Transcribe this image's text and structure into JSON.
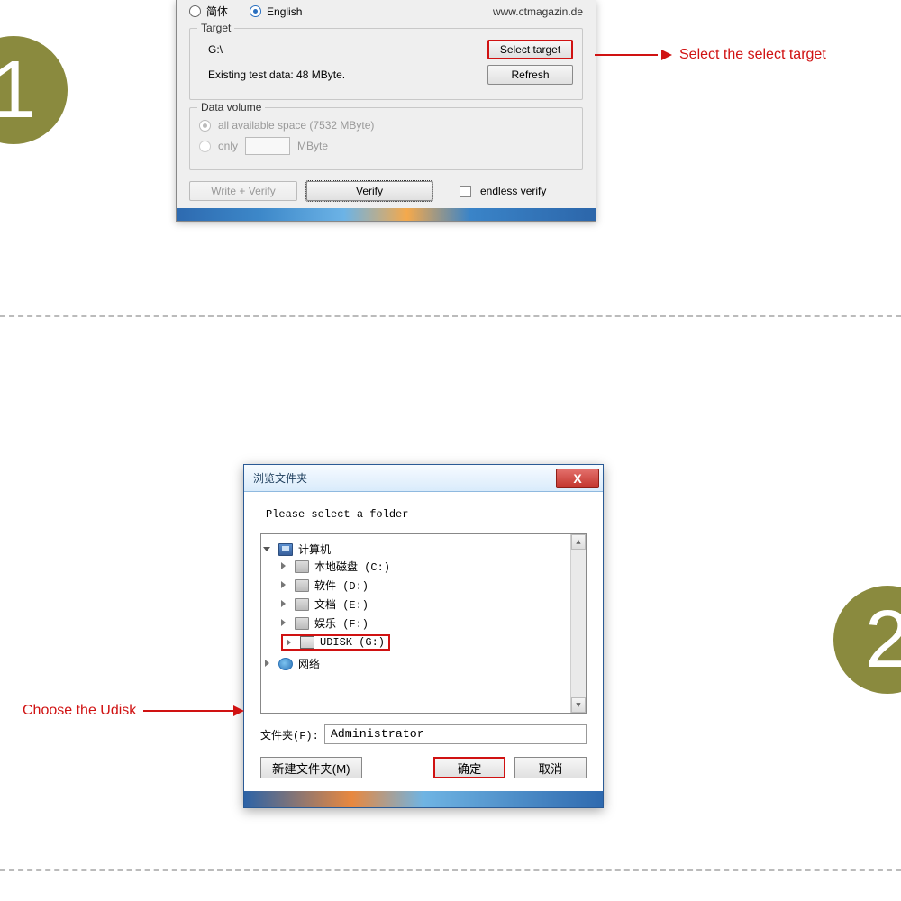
{
  "badges": {
    "one": "1",
    "two": "2"
  },
  "annotations": {
    "step1": "Select the select target",
    "step2": "Choose the Udisk"
  },
  "win1": {
    "lang": {
      "cn": "简体",
      "en": "English"
    },
    "url": "www.ctmagazin.de",
    "target": {
      "label": "Target",
      "drive": "G:\\",
      "select_btn": "Select target",
      "existing": "Existing test data: 48 MByte.",
      "refresh": "Refresh"
    },
    "volume": {
      "label": "Data volume",
      "all": "all available space (7532 MByte)",
      "only": "only",
      "unit": "MByte"
    },
    "actions": {
      "write_verify": "Write + Verify",
      "verify": "Verify",
      "endless": "endless verify"
    }
  },
  "dlg2": {
    "title": "浏览文件夹",
    "close": "X",
    "instruction": "Please select a folder",
    "tree": {
      "computer": "计算机",
      "c": "本地磁盘 (C:)",
      "d": "软件 (D:)",
      "e": "文档 (E:)",
      "f": "娱乐 (F:)",
      "g": "UDISK (G:)",
      "net": "网络"
    },
    "folder_label": "文件夹(F):",
    "folder_value": "Administrator",
    "buttons": {
      "newfolder": "新建文件夹(M)",
      "ok": "确定",
      "cancel": "取消"
    }
  }
}
